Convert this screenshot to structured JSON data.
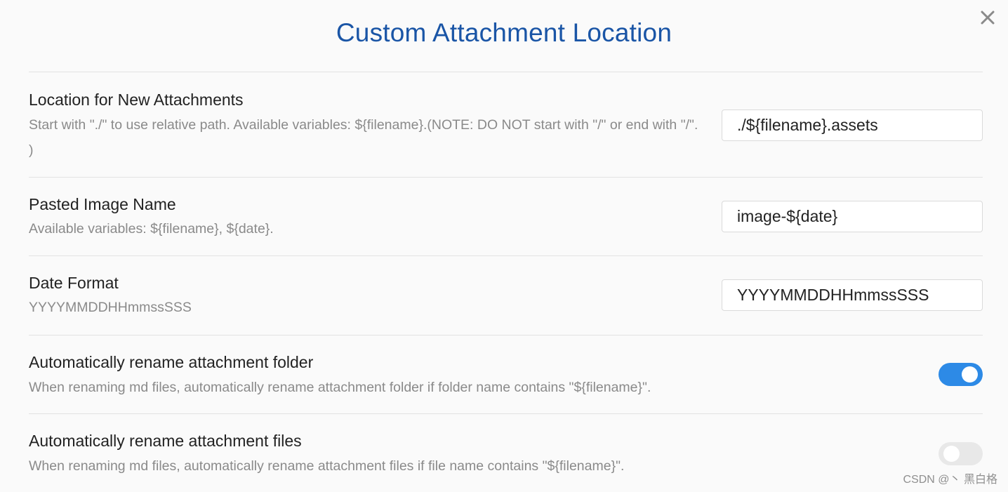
{
  "dialog": {
    "title": "Custom Attachment Location",
    "close_icon": "close-icon"
  },
  "settings": [
    {
      "name": "Location for New Attachments",
      "description": "Start with \"./\" to use relative path. Available variables: ${filename}.(NOTE: DO NOT start with \"/\" or end with \"/\". )",
      "control": "text",
      "value": "./${filename}.assets"
    },
    {
      "name": "Pasted Image Name",
      "description": "Available variables: ${filename}, ${date}.",
      "control": "text",
      "value": "image-${date}"
    },
    {
      "name": "Date Format",
      "description": "YYYYMMDDHHmmssSSS",
      "control": "text",
      "value": "YYYYMMDDHHmmssSSS"
    },
    {
      "name": "Automatically rename attachment folder",
      "description": "When renaming md files, automatically rename attachment folder if folder name contains \"${filename}\".",
      "control": "toggle",
      "enabled": true
    },
    {
      "name": "Automatically rename attachment files",
      "description": "When renaming md files, automatically rename attachment files if file name contains \"${filename}\".",
      "control": "toggle",
      "enabled": false
    }
  ],
  "colors": {
    "title": "#1a55a6",
    "toggle_on": "#2d8ae6",
    "toggle_off": "#e8e8e8",
    "description": "#8a8a8a"
  },
  "watermark": "CSDN @丶 黑白格"
}
